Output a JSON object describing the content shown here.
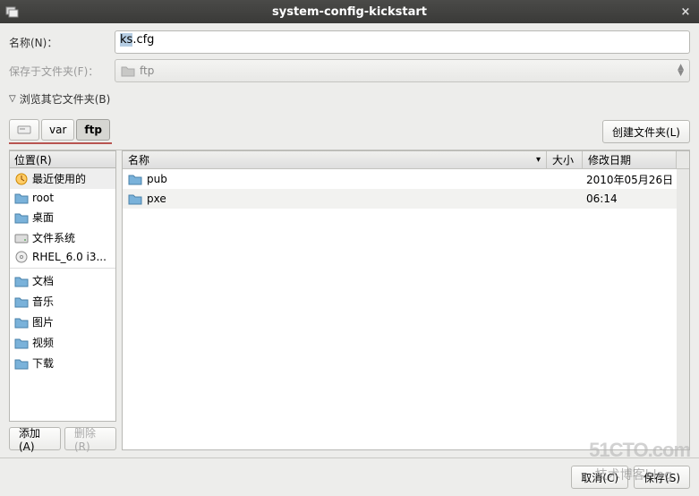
{
  "window": {
    "title": "system-config-kickstart"
  },
  "name_row": {
    "label": "名称(N)：",
    "value_prefix": "ks",
    "value_suffix": ".cfg"
  },
  "folder_row": {
    "label": "保存于文件夹(F)：",
    "value": "ftp"
  },
  "expander": {
    "label": "浏览其它文件夹(B)"
  },
  "breadcrumb": {
    "items": [
      "",
      "var",
      "ftp"
    ],
    "active_index": 2
  },
  "create_folder_btn": "创建文件夹(L)",
  "sidebar": {
    "header": "位置(R)",
    "items_top": [
      {
        "icon": "recent",
        "label": "最近使用的"
      },
      {
        "icon": "folder",
        "label": "root"
      },
      {
        "icon": "folder",
        "label": "桌面"
      },
      {
        "icon": "drive",
        "label": "文件系统"
      },
      {
        "icon": "disc",
        "label": "RHEL_6.0 i3..."
      }
    ],
    "items_bottom": [
      {
        "icon": "folder",
        "label": "文档"
      },
      {
        "icon": "folder",
        "label": "音乐"
      },
      {
        "icon": "folder",
        "label": "图片"
      },
      {
        "icon": "folder",
        "label": "视频"
      },
      {
        "icon": "folder",
        "label": "下载"
      }
    ],
    "add_btn": "添加(A)",
    "remove_btn": "删除(R)"
  },
  "filelist": {
    "columns": {
      "name": "名称",
      "size": "大小",
      "date": "修改日期"
    },
    "rows": [
      {
        "name": "pub",
        "size": "",
        "date": "2010年05月26日"
      },
      {
        "name": "pxe",
        "size": "",
        "date": "06:14"
      }
    ]
  },
  "footer": {
    "cancel": "取消(C)",
    "save": "保存(S)"
  },
  "watermark": {
    "main": "51CTO.com",
    "sub": "技术博客blog"
  }
}
